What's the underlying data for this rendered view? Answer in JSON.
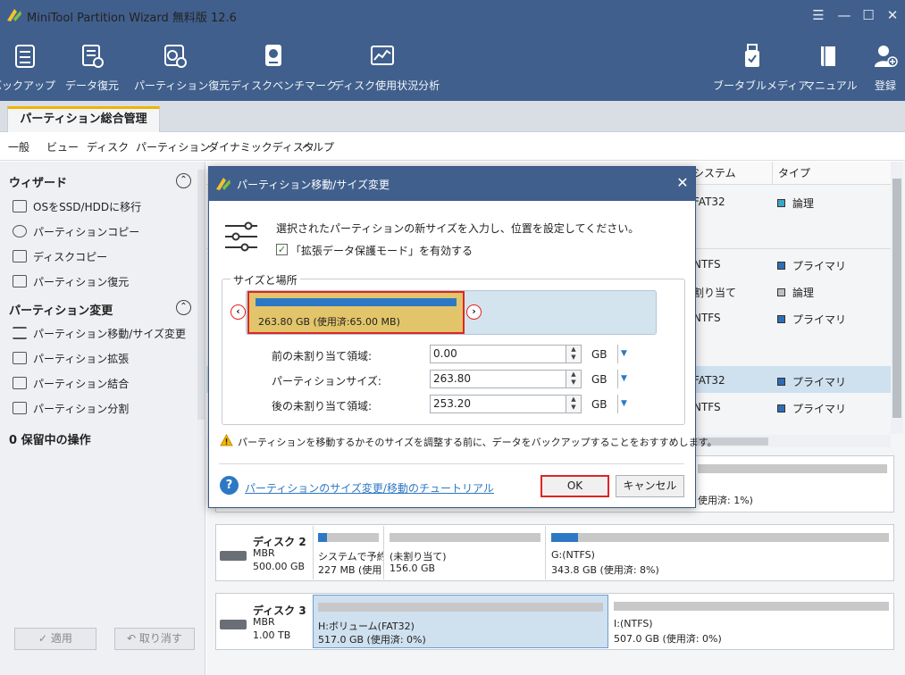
{
  "app": {
    "title": "MiniTool Partition Wizard 無料版 12.6"
  },
  "toolbar": {
    "backup": "バックアップ",
    "data_recovery": "データ復元",
    "partition_recovery": "パーティション復元",
    "disk_benchmark": "ディスクベンチマーク",
    "space_analyzer": "ディスク使用状況分析",
    "bootable_media": "ブータブルメディア",
    "manual": "マニュアル",
    "register": "登録"
  },
  "tab": {
    "main": "パーティション総合管理"
  },
  "menu": [
    "一般",
    "ビュー",
    "ディスク",
    "パーティション",
    "ダイナミックディスク",
    "ヘルプ"
  ],
  "left": {
    "wizard_title": "ウィザード",
    "wizard_items": [
      "OSをSSD/HDDに移行",
      "パーティションコピー",
      "ディスクコピー",
      "パーティション復元"
    ],
    "change_title": "パーティション変更",
    "change_items": [
      "パーティション移動/サイズ変更",
      "パーティション拡張",
      "パーティション結合",
      "パーティション分割"
    ],
    "pending": "0 保留中の操作",
    "apply": "適用",
    "undo": "取り消す"
  },
  "table": {
    "headers": [
      "システム",
      "タイプ"
    ],
    "rows": [
      {
        "fs": "FAT32",
        "type": "論理",
        "color": "#3aa6c9"
      },
      {
        "fs": "NTFS",
        "type": "プライマリ",
        "color": "#2d6db5"
      },
      {
        "fs": "割り当て",
        "type": "論理",
        "color": "#bfbfbf"
      },
      {
        "fs": "NTFS",
        "type": "プライマリ",
        "color": "#2d6db5"
      },
      {
        "fs": "FAT32",
        "type": "プライマリ",
        "color": "#2d6db5"
      },
      {
        "fs": "NTFS",
        "type": "プライマリ",
        "color": "#2d6db5"
      }
    ]
  },
  "disks": {
    "disk1_used": "使用済: 1%)",
    "disk2": {
      "name": "ディスク 2",
      "scheme": "MBR",
      "size": "500.00 GB",
      "parts": [
        {
          "l1": "システムで予約",
          "l2": "227 MB (使用",
          "fill": 0.15
        },
        {
          "l1": "(未割り当て)",
          "l2": "156.0 GB",
          "fill": 0.0
        },
        {
          "l1": "G:(NTFS)",
          "l2": "343.8 GB (使用済: 8%)",
          "fill": 0.08
        }
      ]
    },
    "disk3": {
      "name": "ディスク 3",
      "scheme": "MBR",
      "size": "1.00 TB",
      "parts": [
        {
          "l1": "H:ボリューム(FAT32)",
          "l2": "517.0 GB (使用済: 0%)",
          "fill": 0.0
        },
        {
          "l1": "I:(NTFS)",
          "l2": "507.0 GB (使用済: 0%)",
          "fill": 0.0
        }
      ]
    }
  },
  "dialog": {
    "title": "パーティション移動/サイズ変更",
    "description": "選択されたパーティションの新サイズを入力し、位置を設定してください。",
    "checkbox_label": "「拡張データ保護モード」を有効する",
    "group_label": "サイズと場所",
    "partition_label": "263.80 GB (使用済:65.00 MB)",
    "fields": [
      {
        "label": "前の未割り当て領域:",
        "value": "0.00",
        "unit": "GB"
      },
      {
        "label": "パーティションサイズ:",
        "value": "263.80",
        "unit": "GB"
      },
      {
        "label": "後の未割り当て領域:",
        "value": "253.20",
        "unit": "GB"
      }
    ],
    "warning": "パーティションを移動するかそのサイズを調整する前に、データをバックアップすることをおすすめします。",
    "help_link": "パーティションのサイズ変更/移動のチュートリアル",
    "ok": "OK",
    "cancel": "キャンセル"
  }
}
